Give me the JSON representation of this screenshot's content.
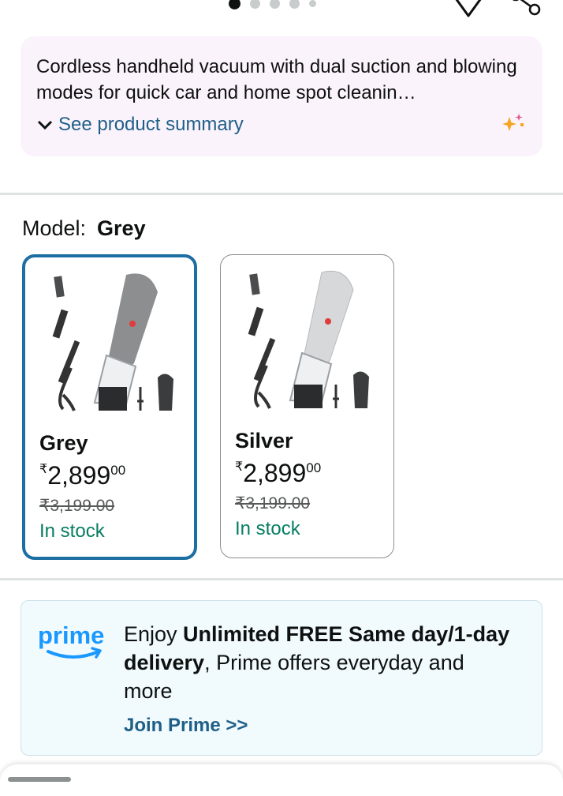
{
  "carousel": {
    "dot_count": 5,
    "active_index": 0
  },
  "summary": {
    "text": "Cordless handheld vacuum with dual suction and blowing modes for quick car and home spot cleanin…",
    "link_label": "See product summary"
  },
  "model": {
    "label": "Model:",
    "selected": "Grey"
  },
  "variants": [
    {
      "name": "Grey",
      "price_symbol": "₹",
      "price_whole": "2,899",
      "price_fraction": "00",
      "mrp": "₹3,199.00",
      "stock": "In stock",
      "selected": true,
      "body_color": "#8c8e90"
    },
    {
      "name": "Silver",
      "price_symbol": "₹",
      "price_whole": "2,899",
      "price_fraction": "00",
      "mrp": "₹3,199.00",
      "stock": "In stock",
      "selected": false,
      "body_color": "#d6d8da"
    }
  ],
  "prime": {
    "logo_text": "prime",
    "text_pre": "Enjoy ",
    "text_bold": "Unlimited FREE Same day/1-day delivery",
    "text_post": ", Prime offers everyday and more",
    "link_label": "Join Prime >>"
  },
  "colors": {
    "link": "#1f5f87",
    "stock": "#067d62",
    "selected_border": "#1d6ea3",
    "prime_blue": "#1a98ff"
  }
}
